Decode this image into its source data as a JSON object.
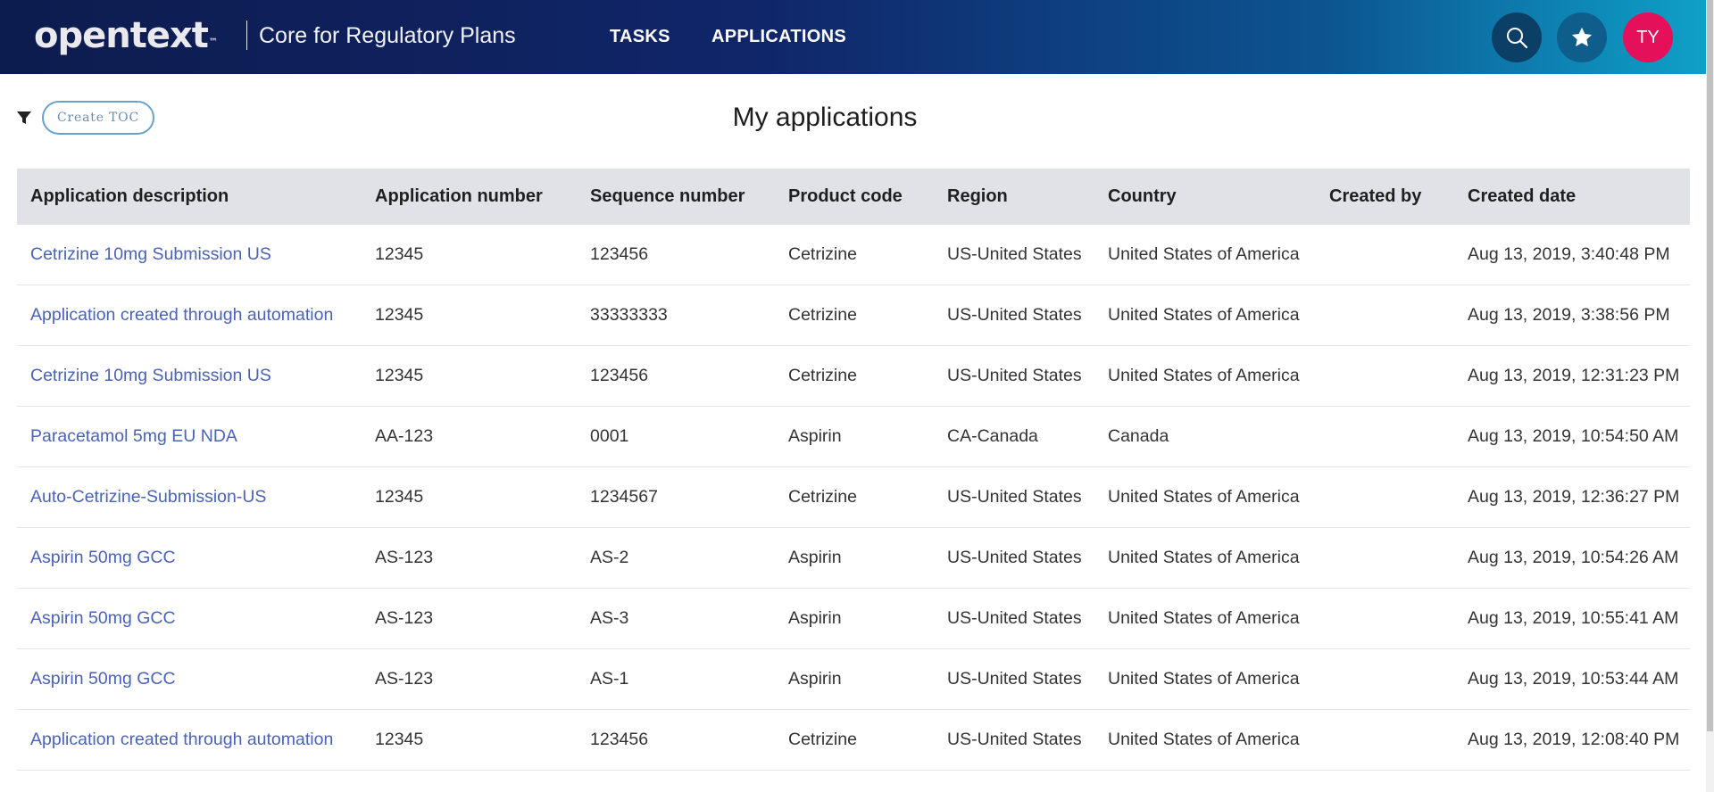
{
  "header": {
    "logo_text": "opentext",
    "logo_tm": "™",
    "app_name": "Core for Regulatory Plans",
    "nav": [
      {
        "label": "TASKS"
      },
      {
        "label": "APPLICATIONS"
      }
    ],
    "search_icon": "search-icon",
    "favorites_icon": "star-icon",
    "user_initials": "TY",
    "colors": {
      "gradient_start": "#0d1c4e",
      "gradient_end": "#0fa0c8",
      "user_avatar": "#e4105a"
    }
  },
  "toolbar": {
    "filter_icon": "filter-icon",
    "create_toc_label": "Create TOC"
  },
  "page_title": "My applications",
  "table": {
    "columns": [
      "Application description",
      "Application number",
      "Sequence number",
      "Product code",
      "Region",
      "Country",
      "Created by",
      "Created date"
    ],
    "rows": [
      [
        "Cetrizine 10mg Submission US",
        "12345",
        "123456",
        "Cetrizine",
        "US-United States",
        "United States of America",
        "",
        "Aug 13, 2019, 3:40:48 PM"
      ],
      [
        "Application created through automation",
        "12345",
        "33333333",
        "Cetrizine",
        "US-United States",
        "United States of America",
        "",
        "Aug 13, 2019, 3:38:56 PM"
      ],
      [
        "Cetrizine 10mg Submission US",
        "12345",
        "123456",
        "Cetrizine",
        "US-United States",
        "United States of America",
        "",
        "Aug 13, 2019, 12:31:23 PM"
      ],
      [
        "Paracetamol 5mg EU NDA",
        "AA-123",
        "0001",
        "Aspirin",
        "CA-Canada",
        "Canada",
        "",
        "Aug 13, 2019, 10:54:50 AM"
      ],
      [
        "Auto-Cetrizine-Submission-US",
        "12345",
        "1234567",
        "Cetrizine",
        "US-United States",
        "United States of America",
        "",
        "Aug 13, 2019, 12:36:27 PM"
      ],
      [
        "Aspirin 50mg GCC",
        "AS-123",
        "AS-2",
        "Aspirin",
        "US-United States",
        "United States of America",
        "",
        "Aug 13, 2019, 10:54:26 AM"
      ],
      [
        "Aspirin 50mg GCC",
        "AS-123",
        "AS-3",
        "Aspirin",
        "US-United States",
        "United States of America",
        "",
        "Aug 13, 2019, 10:55:41 AM"
      ],
      [
        "Aspirin 50mg GCC",
        "AS-123",
        "AS-1",
        "Aspirin",
        "US-United States",
        "United States of America",
        "",
        "Aug 13, 2019, 10:53:44 AM"
      ],
      [
        "Application created through automation",
        "12345",
        "123456",
        "Cetrizine",
        "US-United States",
        "United States of America",
        "",
        "Aug 13, 2019, 12:08:40 PM"
      ]
    ],
    "link_color": "#4a63b8",
    "header_bg": "#e0e2e7"
  }
}
